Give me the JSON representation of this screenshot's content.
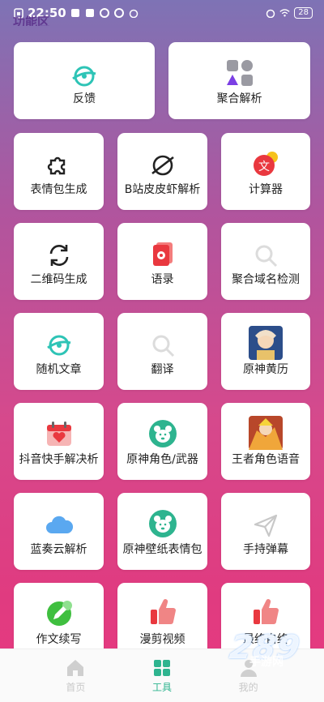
{
  "status_bar": {
    "time": "22:50",
    "battery": "28"
  },
  "page_title": "功能区",
  "cards": [
    {
      "label": "反馈",
      "icon": "planet-orbit-icon"
    },
    {
      "label": "聚合解析",
      "icon": "shapes-icon"
    },
    {
      "label": "表情包生成",
      "icon": "puzzle-icon"
    },
    {
      "label": "B站皮皮虾解析",
      "icon": "planet-icon"
    },
    {
      "label": "计算器",
      "icon": "text-badge-icon"
    },
    {
      "label": "二维码生成",
      "icon": "refresh-icon"
    },
    {
      "label": "语录",
      "icon": "flower-card-icon"
    },
    {
      "label": "聚合域名检测",
      "icon": "search-icon"
    },
    {
      "label": "随机文章",
      "icon": "planet-orbit-icon"
    },
    {
      "label": "翻译",
      "icon": "search-icon"
    },
    {
      "label": "原神黄历",
      "icon": "game-character-thumbnail"
    },
    {
      "label": "抖音快手解决析",
      "icon": "calendar-heart-icon"
    },
    {
      "label": "原神角色/武器",
      "icon": "bear-icon"
    },
    {
      "label": "王者角色语音",
      "icon": "game-hero-thumbnail"
    },
    {
      "label": "蓝奏云解析",
      "icon": "cloud-icon"
    },
    {
      "label": "原神壁纸表情包",
      "icon": "bear-icon"
    },
    {
      "label": "手持弹幕",
      "icon": "paper-plane-icon"
    },
    {
      "label": "作文续写",
      "icon": "pencil-circle-icon"
    },
    {
      "label": "漫剪视频",
      "icon": "thumbs-up-icon"
    },
    {
      "label": "最终自终",
      "icon": "thumbs-up-icon"
    }
  ],
  "bottom_nav": [
    {
      "label": "首页",
      "icon": "home-icon",
      "active": false
    },
    {
      "label": "工具",
      "icon": "grid-icon",
      "active": true
    },
    {
      "label": "我的",
      "icon": "person-icon",
      "active": false
    }
  ],
  "watermark": {
    "logo": "289",
    "domain": "手游网"
  },
  "colors": {
    "accent": "#2eb48f",
    "inactive": "#c8c8c8"
  }
}
